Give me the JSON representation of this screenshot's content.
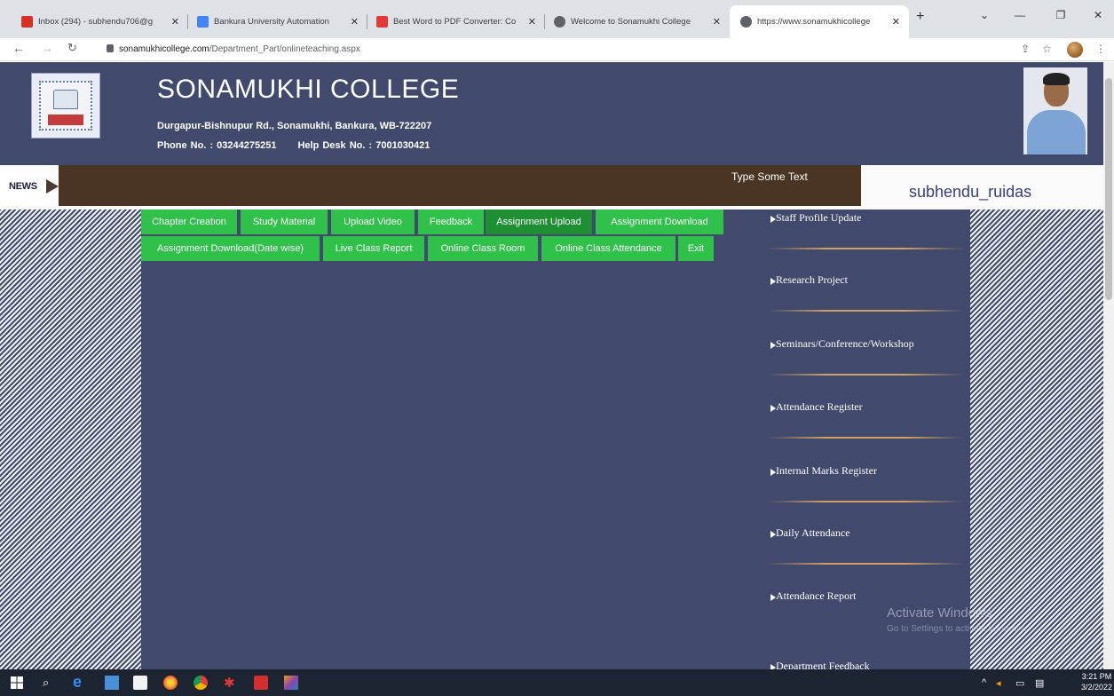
{
  "browser": {
    "tabs": [
      {
        "title": "Inbox (294) - subhendu706@g",
        "favicon_color": "#d93025",
        "active": false
      },
      {
        "title": "Bankura University Automation",
        "favicon_color": "#4285f4",
        "active": false
      },
      {
        "title": "Best Word to PDF Converter: Co",
        "favicon_color": "#e53935",
        "active": false
      },
      {
        "title": "Welcome to Sonamukhi College",
        "favicon_color": "#5f6368",
        "active": false
      },
      {
        "title": "https://www.sonamukhicollege",
        "favicon_color": "#5f6368",
        "active": true
      }
    ],
    "new_tab": "+",
    "url_host": "sonamukhicollege.com",
    "url_path": "/Department_Part/onlineteaching.aspx"
  },
  "header": {
    "college_name": "SONAMUKHI COLLEGE",
    "address": "Durgapur-Bishnupur Rd., Sonamukhi, Bankura, WB-722207",
    "phone": "Phone No. : 03244275251",
    "helpdesk": "Help Desk No. : 7001030421"
  },
  "news": {
    "label": "NEWS",
    "ticker": "Type Some Text",
    "username": "subhendu_ruidas"
  },
  "menu": {
    "row1": [
      "Chapter Creation",
      "Study Material",
      "Upload Video",
      "Feedback",
      "Assignment Upload",
      "Assignment Download"
    ],
    "row2": [
      "Assignment Download(Date wise)",
      "Live Class Report",
      "Online Class Room",
      "Online Class Attendance",
      "Exit"
    ],
    "active_item": "Assignment Upload"
  },
  "sidebar": {
    "items": [
      "Staff Profile Update",
      "Research Project",
      "Seminars/Conference/Workshop",
      "Attendance Register",
      "Internal Marks Register",
      "Daily Attendance",
      "Attendance Report",
      "Department Feedback"
    ]
  },
  "watermark": {
    "line1": "Activate Windows",
    "line2": "Go to Settings to activate Windows."
  },
  "taskbar": {
    "time": "3:21 PM",
    "date": "3/2/2022"
  }
}
